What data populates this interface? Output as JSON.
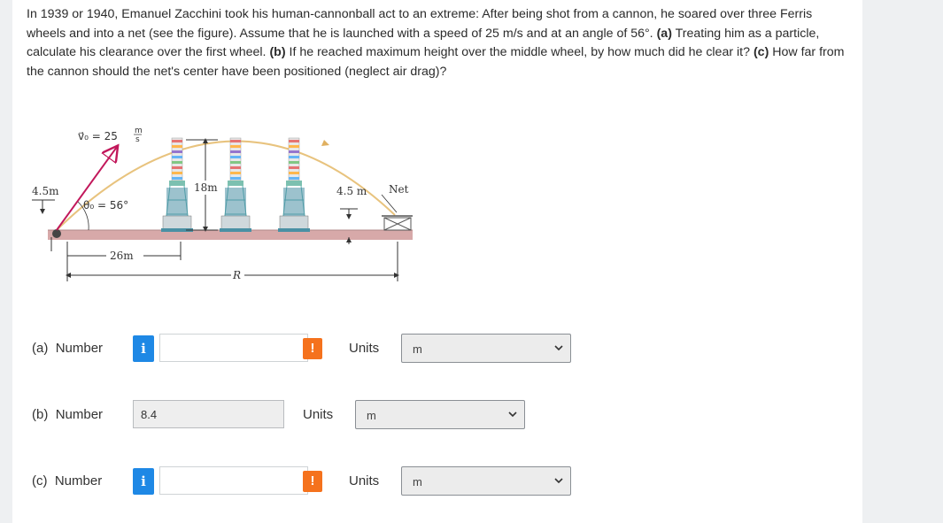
{
  "problem": {
    "intro": "In 1939 or 1940, Emanuel Zacchini took his human-cannonball act to an extreme: After being shot from a cannon, he soared over three Ferris wheels and into a net (see the figure). Assume that he is launched with a speed of 25 m/s and at an angle of 56°.",
    "part_a_tag": "(a)",
    "part_a_text": "Treating him as a particle, calculate his clearance over the first wheel.",
    "part_b_tag": "(b)",
    "part_b_text": "If he reached maximum height over the middle wheel, by how much did he clear it?",
    "part_c_tag": "(c)",
    "part_c_text": "How far from the cannon should the net's center have been positioned (neglect air drag)?"
  },
  "figure": {
    "v0_label": "v⃗₀ = 25",
    "v0_unit_num": "m",
    "v0_unit_den": "s",
    "theta_label": "θ₀ = 56°",
    "h_left": "4.5m",
    "h_wheel": "18m",
    "h_right": "4.5 m",
    "net_label": "Net",
    "dist_26": "26m",
    "dist_R": "R",
    "colors": {
      "trajectory": "#e8c37e",
      "ground": "#d7a9a9",
      "tower": "#4a90a4",
      "cannon": "#c2185b"
    }
  },
  "answers": [
    {
      "part": "(a)",
      "number_label": "Number",
      "info_icon": "info-icon",
      "value": "",
      "placeholder": "",
      "warn_icon": "exclamation-icon",
      "units_label": "Units",
      "units_value": "m"
    },
    {
      "part": "(b)",
      "number_label": "Number",
      "value": "8.4",
      "units_label": "Units",
      "units_value": "m"
    },
    {
      "part": "(c)",
      "number_label": "Number",
      "info_icon": "info-icon",
      "value": "",
      "placeholder": "",
      "warn_icon": "exclamation-icon",
      "units_label": "Units",
      "units_value": "m"
    }
  ],
  "icons": {
    "info": "i",
    "warn": "!"
  }
}
